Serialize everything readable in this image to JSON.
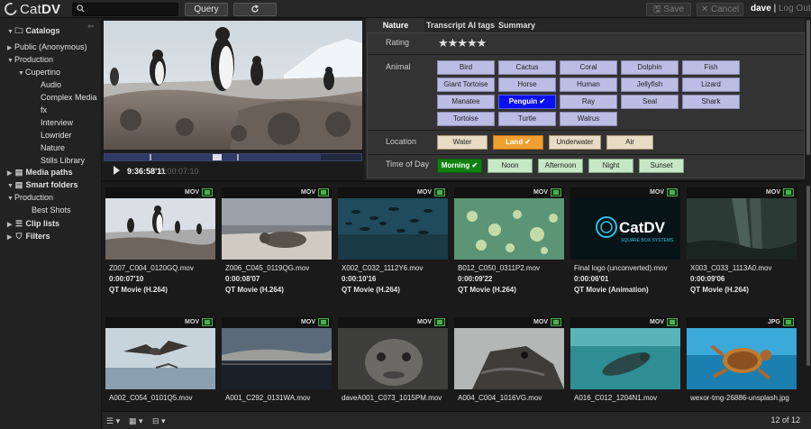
{
  "app": {
    "logo_prefix": "Cat",
    "logo_bold": "DV"
  },
  "toolbar": {
    "search_placeholder": "",
    "query_label": "Query",
    "refresh_icon": "refresh-icon",
    "save_label": "Save",
    "cancel_label": "Cancel",
    "user": "dave",
    "separator": "|",
    "logout": "Log Out"
  },
  "sidebar": {
    "items": [
      {
        "label": "Catalogs",
        "tri": "▼",
        "icon": "🗀"
      },
      {
        "label": "Public (Anonymous)",
        "tri": "▶"
      },
      {
        "label": "Production",
        "tri": "▼"
      },
      {
        "label": "Cupertino",
        "tri": "▼"
      },
      {
        "label": "Audio"
      },
      {
        "label": "Complex Media"
      },
      {
        "label": "fx"
      },
      {
        "label": "Interview"
      },
      {
        "label": "Lowrider"
      },
      {
        "label": "Nature"
      },
      {
        "label": "Stills Library"
      },
      {
        "label": "Media paths",
        "tri": "▶",
        "icon": "▤"
      },
      {
        "label": "Smart folders",
        "tri": "▼",
        "icon": "▤"
      },
      {
        "label": "Production",
        "tri": "▼"
      },
      {
        "label": "Best Shots"
      },
      {
        "label": "Clip lists",
        "tri": "▶",
        "icon": "☰"
      },
      {
        "label": "Filters",
        "tri": "▶",
        "icon": "⛉"
      }
    ]
  },
  "player": {
    "timecode": "9:36:58'11",
    "duration": "0:00:07:10"
  },
  "tabs": [
    "Nature Logging",
    "Transcript",
    "AI tags",
    "Summary"
  ],
  "fields": {
    "rating_label": "Rating",
    "rating_stars": "★★★★★",
    "rating_value": 5,
    "animal_label": "Animal",
    "animals": [
      "Bird",
      "Cactus",
      "Coral",
      "Dolphin",
      "Fish",
      "Giant Tortoise",
      "Horse",
      "Human",
      "Jellyfish",
      "Lizard",
      "Manatee",
      "Penguin ✔",
      "Ray",
      "Seal",
      "Shark",
      "Tortoise",
      "Turtle",
      "Walrus"
    ],
    "location_label": "Location",
    "locations": [
      "Water",
      "Land ✔",
      "Underwater",
      "Air"
    ],
    "time_label": "Time of Day",
    "times": [
      "Morning ✔",
      "Noon",
      "Afternoon",
      "Night",
      "Sunset"
    ]
  },
  "clips": [
    {
      "type": "MOV",
      "name": "Z007_C004_0120GQ.mov",
      "dur": "0:00:07'10",
      "format": "QT Movie (H.264)"
    },
    {
      "type": "MOV",
      "name": "Z006_C045_0119QG.mov",
      "dur": "0:00:08'07",
      "format": "QT Movie (H.264)"
    },
    {
      "type": "MOV",
      "name": "X002_C032_1112Y6.mov",
      "dur": "0:00:10'16",
      "format": "QT Movie (H.264)"
    },
    {
      "type": "MOV",
      "name": "B012_C050_0311P2.mov",
      "dur": "0:00:09'22",
      "format": "QT Movie (H.264)"
    },
    {
      "type": "MOV",
      "name": "Final logo (unconverted).mov",
      "dur": "0:00:06'01",
      "format": "QT Movie (Animation)"
    },
    {
      "type": "MOV",
      "name": "X003_C033_1113A0.mov",
      "dur": "0:00:09'06",
      "format": "QT Movie (H.264)"
    },
    {
      "type": "MOV",
      "name": "A002_C054_0101Q5.mov",
      "dur": "",
      "format": ""
    },
    {
      "type": "MOV",
      "name": "A001_C292_0131WA.mov",
      "dur": "",
      "format": ""
    },
    {
      "type": "MOV",
      "name": "daveA001_C073_1015PM.mov",
      "dur": "",
      "format": ""
    },
    {
      "type": "MOV",
      "name": "A004_C004_1016VG.mov",
      "dur": "",
      "format": ""
    },
    {
      "type": "MOV",
      "name": "A016_C012_1204N1.mov",
      "dur": "",
      "format": ""
    },
    {
      "type": "JPG",
      "name": "wexor-tmg-26886-unsplash.jpg",
      "dur": "",
      "format": ""
    }
  ],
  "logo_card": {
    "brand": "CatDV",
    "tagline": "SQUARE BOX SYSTEMS"
  },
  "bottom": {
    "count": "12 of 12"
  }
}
